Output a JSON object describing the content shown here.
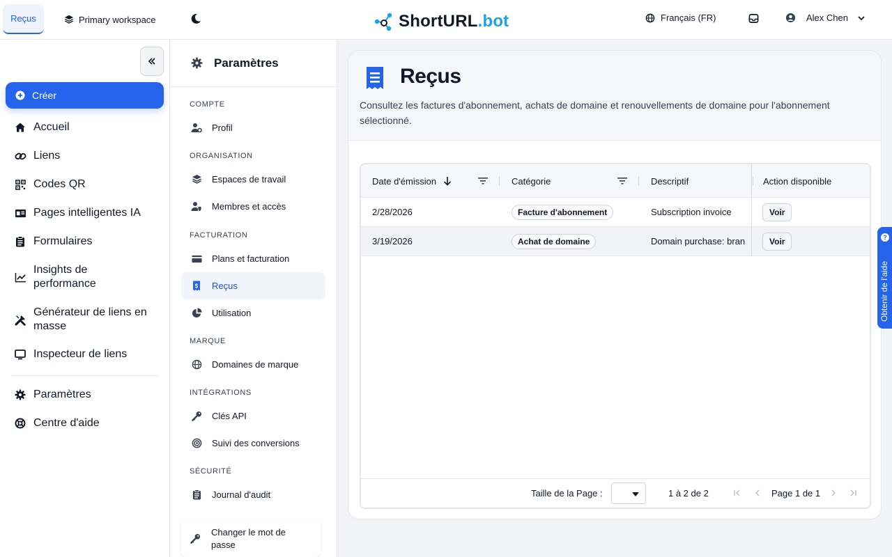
{
  "topbar": {
    "active_tab": "Reçus",
    "workspace": "Primary workspace",
    "logo": {
      "main": "ShortURL",
      "suffix": ".bot"
    },
    "language": "Français (FR)",
    "user_name": "Alex Chen"
  },
  "sidebar": {
    "create_label": "Créer",
    "items": [
      {
        "label": "Accueil",
        "icon": "home-icon"
      },
      {
        "label": "Liens",
        "icon": "link-icon"
      },
      {
        "label": "Codes QR",
        "icon": "qr-code-icon"
      },
      {
        "label": "Pages intelligentes IA",
        "icon": "id-card-icon"
      },
      {
        "label": "Formulaires",
        "icon": "clipboard-icon"
      },
      {
        "label": "Insights de performance",
        "icon": "chart-line-icon"
      },
      {
        "label": "Générateur de liens en masse",
        "icon": "tools-icon"
      },
      {
        "label": "Inspecteur de liens",
        "icon": "monitor-icon"
      }
    ],
    "bottom_items": [
      {
        "label": "Paramètres",
        "icon": "gear-icon"
      },
      {
        "label": "Centre d'aide",
        "icon": "lifebuoy-icon"
      }
    ]
  },
  "settings": {
    "title": "Paramètres",
    "sections": {
      "compte": "COMPTE",
      "organisation": "ORGANISATION",
      "facturation": "FACTURATION",
      "marque": "MARQUE",
      "integrations": "INTÉGRATIONS",
      "securite": "SÉCURITÉ"
    },
    "items": {
      "profil": "Profil",
      "espaces": "Espaces de travail",
      "membres": "Membres et accès",
      "plans": "Plans et facturation",
      "recus": "Reçus",
      "utilisation": "Utilisation",
      "domaines": "Domaines de marque",
      "cles_api": "Clés API",
      "conversions": "Suivi des conversions",
      "journal": "Journal d'audit",
      "password_line1": "Changer le mot de",
      "password_line2": "passe"
    }
  },
  "page": {
    "title": "Reçus",
    "description": "Consultez les factures d'abonnement, achats de domaine et renouvellements de domaine pour l'abonnement sélectionné."
  },
  "table": {
    "columns": {
      "date": "Date d'émission",
      "category": "Catégorie",
      "description": "Descriptif",
      "action": "Action disponible"
    },
    "rows": [
      {
        "date": "2/28/2026",
        "category": "Facture d'abonnement",
        "description": "Subscription invoice",
        "action": "Voir"
      },
      {
        "date": "3/19/2026",
        "category": "Achat de domaine",
        "description": "Domain purchase: bran",
        "action": "Voir"
      }
    ],
    "footer": {
      "page_size_label": "Taille de la Page :",
      "page_size_value": "",
      "range": "1 à 2 de 2",
      "page_label": "Page 1 de 1"
    }
  },
  "help_tab": "Obtenir de l'aide",
  "colors": {
    "accent": "#2563eb",
    "logo_suffix": "#1aa3e8"
  }
}
